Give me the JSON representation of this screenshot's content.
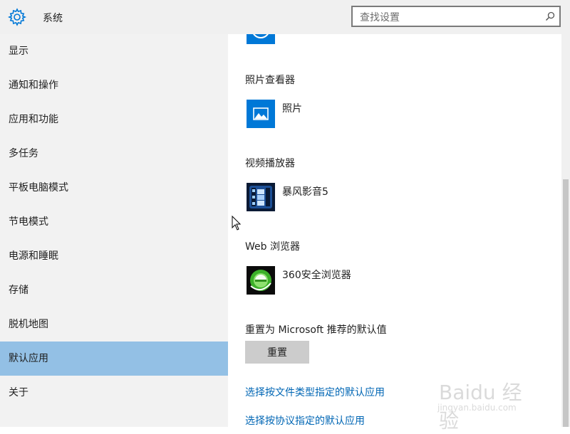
{
  "header": {
    "title": "系统",
    "icon": "gear-icon",
    "search_placeholder": "查找设置"
  },
  "sidebar": {
    "items": [
      {
        "label": "显示"
      },
      {
        "label": "通知和操作"
      },
      {
        "label": "应用和功能"
      },
      {
        "label": "多任务"
      },
      {
        "label": "平板电脑模式"
      },
      {
        "label": "节电模式"
      },
      {
        "label": "电源和睡眠"
      },
      {
        "label": "存储"
      },
      {
        "label": "脱机地图"
      },
      {
        "label": "默认应用",
        "selected": true
      },
      {
        "label": "关于"
      }
    ]
  },
  "main": {
    "sections": [
      {
        "label": "照片查看器",
        "app": {
          "name": "照片",
          "icon": "photos-app-icon"
        }
      },
      {
        "label": "视频播放器",
        "app": {
          "name": "暴风影音5",
          "icon": "baofeng-video-icon"
        }
      },
      {
        "label": "Web 浏览器",
        "app": {
          "name": "360安全浏览器",
          "icon": "360-browser-icon"
        }
      }
    ],
    "reset_label": "重置为 Microsoft 推荐的默认值",
    "reset_button": "重置",
    "links": [
      "选择按文件类型指定的默认应用",
      "选择按协议指定的默认应用"
    ]
  },
  "watermark": {
    "text": "Baidu 经验",
    "sub": "jingyan.baidu.com"
  },
  "colors": {
    "accent": "#0078d7",
    "selected_bg": "#93c0e5",
    "link": "#0066b4",
    "header_bg": "#f0f0f0",
    "sidebar_bg": "#f2f2f2",
    "button_bg": "#cccccc"
  }
}
